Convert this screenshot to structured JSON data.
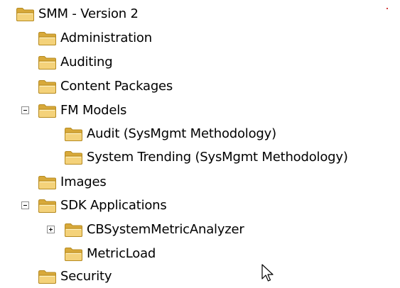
{
  "colors": {
    "folder_fill": "#f4d27a",
    "folder_dark": "#d8a93a",
    "folder_outline": "#b68b21",
    "text": "#000000",
    "expander_border": "#8c8c8c"
  },
  "tree": {
    "root": {
      "label": "SMM - Version 2",
      "icon": "folder-icon"
    },
    "items": [
      {
        "label": "Administration",
        "icon": "folder-icon"
      },
      {
        "label": "Auditing",
        "icon": "folder-icon"
      },
      {
        "label": "Content Packages",
        "icon": "folder-icon"
      },
      {
        "label": "FM Models",
        "icon": "folder-icon",
        "expander": "collapse-icon",
        "expanded": true,
        "children": [
          {
            "label": "Audit (SysMgmt Methodology)",
            "icon": "folder-icon"
          },
          {
            "label": "System Trending (SysMgmt Methodology)",
            "icon": "folder-icon"
          }
        ]
      },
      {
        "label": "Images",
        "icon": "folder-icon"
      },
      {
        "label": "SDK Applications",
        "icon": "folder-icon",
        "expander": "collapse-icon",
        "expanded": true,
        "children": [
          {
            "label": "CBSystemMetricAnalyzer",
            "icon": "folder-icon",
            "expander": "expand-icon",
            "expanded": false
          },
          {
            "label": "MetricLoad",
            "icon": "folder-icon"
          }
        ]
      },
      {
        "label": "Security",
        "icon": "folder-icon"
      }
    ]
  },
  "pointer": {
    "icon": "mouse-pointer-icon"
  }
}
